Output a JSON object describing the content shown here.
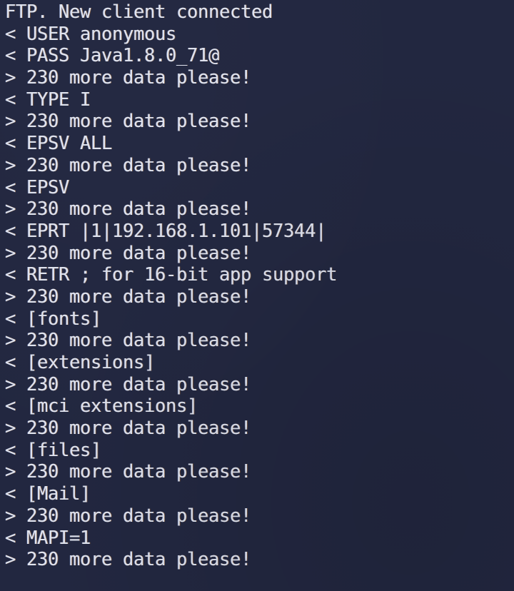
{
  "console": {
    "background_color": "#222740",
    "text_color": "#dfe3ee",
    "title": "FTP. New client connected",
    "lines": [
      {
        "direction": "banner",
        "text": "FTP. New client connected"
      },
      {
        "direction": "in",
        "text": "< USER anonymous"
      },
      {
        "direction": "in",
        "text": "< PASS Java1.8.0_71@"
      },
      {
        "direction": "out",
        "text": "> 230 more data please!"
      },
      {
        "direction": "in",
        "text": "< TYPE I"
      },
      {
        "direction": "out",
        "text": "> 230 more data please!"
      },
      {
        "direction": "in",
        "text": "< EPSV ALL"
      },
      {
        "direction": "out",
        "text": "> 230 more data please!"
      },
      {
        "direction": "in",
        "text": "< EPSV"
      },
      {
        "direction": "out",
        "text": "> 230 more data please!"
      },
      {
        "direction": "in",
        "text": "< EPRT |1|192.168.1.101|57344|"
      },
      {
        "direction": "out",
        "text": "> 230 more data please!"
      },
      {
        "direction": "in",
        "text": "< RETR ; for 16-bit app support"
      },
      {
        "direction": "out",
        "text": "> 230 more data please!"
      },
      {
        "direction": "in",
        "text": "< [fonts]"
      },
      {
        "direction": "out",
        "text": "> 230 more data please!"
      },
      {
        "direction": "in",
        "text": "< [extensions]"
      },
      {
        "direction": "out",
        "text": "> 230 more data please!"
      },
      {
        "direction": "in",
        "text": "< [mci extensions]"
      },
      {
        "direction": "out",
        "text": "> 230 more data please!"
      },
      {
        "direction": "in",
        "text": "< [files]"
      },
      {
        "direction": "out",
        "text": "> 230 more data please!"
      },
      {
        "direction": "in",
        "text": "< [Mail]"
      },
      {
        "direction": "out",
        "text": "> 230 more data please!"
      },
      {
        "direction": "in",
        "text": "< MAPI=1"
      },
      {
        "direction": "out",
        "text": "> 230 more data please!"
      }
    ]
  }
}
